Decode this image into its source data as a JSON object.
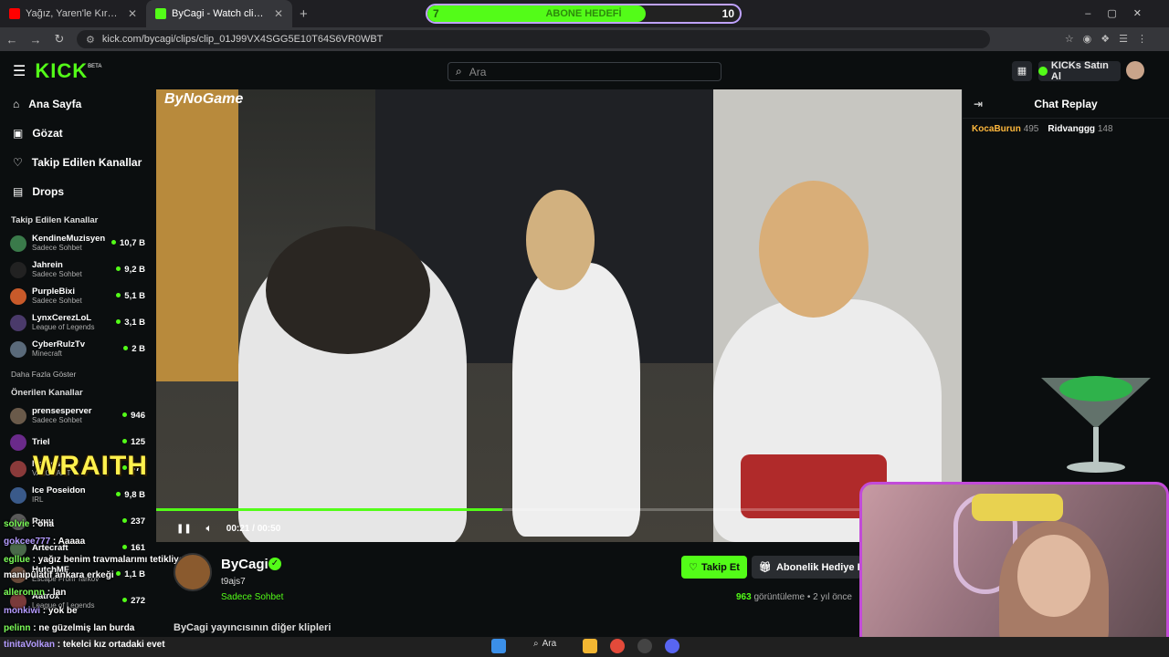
{
  "browser": {
    "tabs": [
      {
        "title": "Yağız, Yaren'le Kırmızı Odada | Y",
        "active": false
      },
      {
        "title": "ByCagi - Watch clips on Kick",
        "active": true
      }
    ],
    "url": "kick.com/bycagi/clips/clip_01J99VX4SGG5E10T64S6VR0WBT"
  },
  "goal": {
    "start": "7",
    "label": "ABONE HEDEFİ",
    "target": "10",
    "progress": 0.7
  },
  "header": {
    "logo": "KICK",
    "logo_badge": "BETA",
    "search_placeholder": "Ara",
    "buy_kicks": "KICKs Satın Al"
  },
  "sidebar": {
    "nav": [
      {
        "label": "Ana Sayfa",
        "icon": "home-icon",
        "glyph": "⌂"
      },
      {
        "label": "Gözat",
        "icon": "browse-icon",
        "glyph": "▣"
      },
      {
        "label": "Takip Edilen Kanallar",
        "icon": "heart-icon",
        "glyph": "♡"
      },
      {
        "label": "Drops",
        "icon": "drops-icon",
        "glyph": "▤"
      }
    ],
    "following_title": "Takip Edilen Kanallar",
    "following": [
      {
        "name": "KendineMuzisyen",
        "category": "Sadece Sohbet",
        "viewers": "10,7 B",
        "color": "#3a7a4a"
      },
      {
        "name": "Jahrein",
        "category": "Sadece Sohbet",
        "viewers": "9,2 B",
        "color": "#222"
      },
      {
        "name": "PurpleBixi",
        "category": "Sadece Sohbet",
        "viewers": "5,1 B",
        "color": "#c85a2a"
      },
      {
        "name": "LynxCerezLoL",
        "category": "League of Legends",
        "viewers": "3,1 B",
        "color": "#4a3a6a"
      },
      {
        "name": "CyberRulzTv",
        "category": "Minecraft",
        "viewers": "2 B",
        "color": "#5a6a7a"
      }
    ],
    "show_more": "Daha Fazla Göster",
    "recommended_title": "Önerilen Kanallar",
    "recommended": [
      {
        "name": "prensesperver",
        "category": "Sadece Sohbet",
        "viewers": "946",
        "color": "#6a5a4a"
      },
      {
        "name": "Triel",
        "category": "",
        "viewers": "125",
        "color": "#6a2a8a"
      },
      {
        "name": "Nemesis",
        "category": "VALORANT",
        "viewers": "374",
        "color": "#8a3a3a"
      },
      {
        "name": "Ice Poseidon",
        "category": "IRL",
        "viewers": "9,8 B",
        "color": "#3a5a8a"
      },
      {
        "name": "Ryuu",
        "category": "",
        "viewers": "237",
        "color": "#5a5a5a"
      },
      {
        "name": "Artecraft",
        "category": "",
        "viewers": "161",
        "color": "#4a6a4a"
      },
      {
        "name": "HutchMF",
        "category": "Escape From Tarkov",
        "viewers": "1,1 B",
        "color": "#6a4a3a"
      },
      {
        "name": "Aatrox",
        "category": "League of Legends",
        "viewers": "272",
        "color": "#7a3a3a"
      }
    ]
  },
  "video": {
    "watermark": "ByNoGame",
    "current_time": "00:21",
    "duration": "00:50",
    "progress": 0.43
  },
  "clip": {
    "channel": "ByCagi",
    "title": "t9ajs7",
    "category": "Sadece Sohbet",
    "follow": "Takip Et",
    "gift": "Abonelik Hediye Et",
    "views_count": "963",
    "views_label": "görüntüleme",
    "age": "2 yıl önce",
    "other_clips": "ByCagi yayıncısının diğer klipleri"
  },
  "chat": {
    "title": "Chat Replay",
    "leaderboard": [
      {
        "name": "KocaBurun",
        "count": "495"
      },
      {
        "name": "Ridvanggg",
        "count": "148"
      }
    ]
  },
  "overlay_chat": [
    {
      "user": "solvie",
      "msg": "oha"
    },
    {
      "user": "gokcee777",
      "msg": "Aaaaa"
    },
    {
      "user": "egllue",
      "msg": "yağız benim travmalarımı tetikliyo"
    },
    {
      "user": "",
      "msg": "manipülatif ankara erkeği"
    },
    {
      "user": "alleronnn",
      "msg": "lan"
    },
    {
      "user": "monkiwi",
      "msg": "yok be"
    },
    {
      "user": "pelinn",
      "msg": "ne güzelmiş lan burda"
    }
  ],
  "overlay_alert": "WRAITH",
  "taskbar": {
    "chat_user": "tinitaVolkan",
    "chat_msg": "tekelci kız ortadaki evet",
    "search": "Ara"
  }
}
